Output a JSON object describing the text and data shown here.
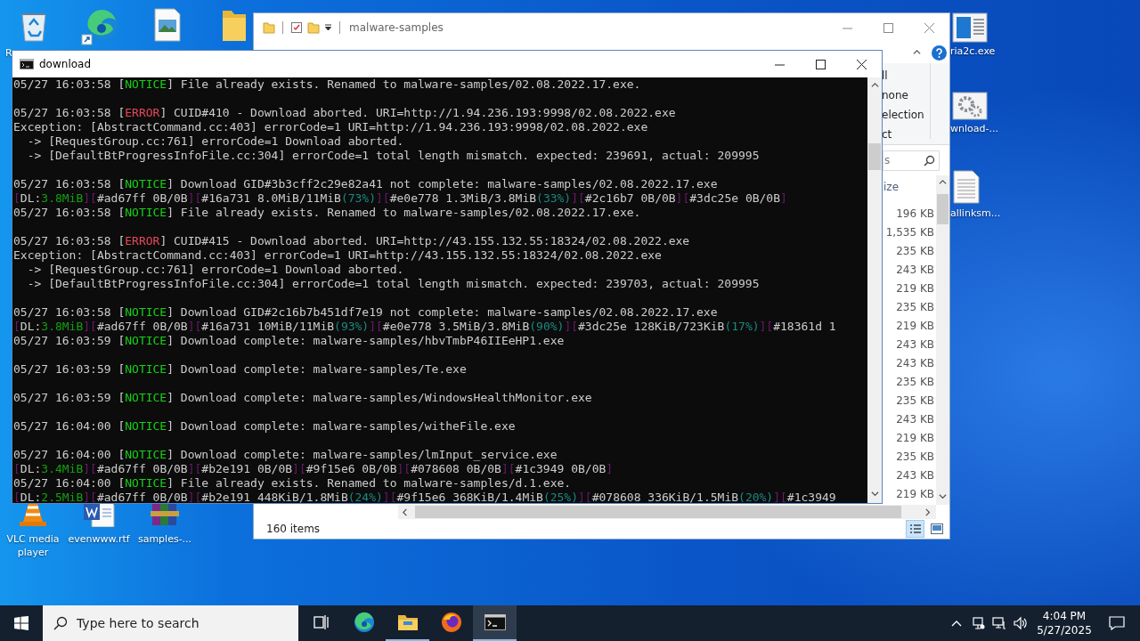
{
  "desktop_icons_top": [
    {
      "kind": "recycle",
      "label": "R"
    },
    {
      "kind": "edge"
    },
    {
      "kind": "image"
    },
    {
      "kind": "folder"
    }
  ],
  "desktop_icons_right": [
    {
      "kind": "app",
      "label": "ria2c.exe"
    },
    {
      "kind": "gear",
      "label": "wnload-..."
    },
    {
      "kind": "text",
      "label": "allinksm..."
    }
  ],
  "desktop_icons_bottom": [
    {
      "kind": "vlc",
      "label": "VLC media player"
    },
    {
      "kind": "word",
      "label": "evenwww.rtf"
    },
    {
      "kind": "archive",
      "label": "samples-..."
    }
  ],
  "explorer": {
    "title": "malware-samples",
    "ribbon_items": [
      "ll",
      "none",
      "election",
      "ct"
    ],
    "search": {
      "placeholder": "s"
    },
    "column": "ize",
    "sizes": [
      "196 KB",
      "1,535 KB",
      "235 KB",
      "243 KB",
      "219 KB",
      "235 KB",
      "219 KB",
      "243 KB",
      "243 KB",
      "235 KB",
      "235 KB",
      "243 KB",
      "219 KB",
      "235 KB",
      "243 KB",
      "219 KB"
    ],
    "status": "160 items",
    "views": [
      {
        "kind": "details",
        "selected": true
      },
      {
        "kind": "thumbnails",
        "selected": false
      }
    ]
  },
  "console": {
    "title": "download",
    "blocks": [
      {
        "lines": [
          {
            "segments": [
              {
                "kind": "text",
                "text": "05/27 16:03:58 ["
              },
              {
                "kind": "notice",
                "text": "NOTICE"
              },
              {
                "kind": "text",
                "text": "] File already exists. Renamed to malware-samples/02.08.2022.17.exe."
              }
            ]
          }
        ]
      },
      {
        "lines": [
          {
            "segments": [
              {
                "kind": "text",
                "text": "05/27 16:03:58 ["
              },
              {
                "kind": "error",
                "text": "ERROR"
              },
              {
                "kind": "text",
                "text": "] CUID#410 - Download aborted. URI=http://1.94.236.193:9998/02.08.2022.exe"
              }
            ]
          },
          {
            "segments": [
              {
                "kind": "text",
                "text": "Exception: [AbstractCommand.cc:403] errorCode=1 URI=http://1.94.236.193:9998/02.08.2022.exe"
              }
            ]
          },
          {
            "segments": [
              {
                "kind": "text",
                "text": "  -> [RequestGroup.cc:761] errorCode=1 Download aborted."
              }
            ]
          },
          {
            "segments": [
              {
                "kind": "text",
                "text": "  -> [DefaultBtProgressInfoFile.cc:304] errorCode=1 total length mismatch. expected: 239691, actual: 209995"
              }
            ]
          }
        ]
      },
      {
        "lines": [
          {
            "segments": [
              {
                "kind": "text",
                "text": "05/27 16:03:58 ["
              },
              {
                "kind": "notice",
                "text": "NOTICE"
              },
              {
                "kind": "text",
                "text": "] Download GID#3b3cff2c29e82a41 not complete: malware-samples/02.08.2022.17.exe"
              }
            ]
          },
          {
            "segments": [
              {
                "kind": "bracket",
                "text": "["
              },
              {
                "kind": "text",
                "text": "DL:"
              },
              {
                "kind": "speed",
                "text": "3.8MiB"
              },
              {
                "kind": "bracket",
                "text": "]["
              },
              {
                "kind": "text",
                "text": "#ad67ff 0B/0B"
              },
              {
                "kind": "bracket",
                "text": "]["
              },
              {
                "kind": "text",
                "text": "#16a731 8.0MiB/11MiB"
              },
              {
                "kind": "percent",
                "text": "(73%)"
              },
              {
                "kind": "bracket",
                "text": "]["
              },
              {
                "kind": "text",
                "text": "#e0e778 1.3MiB/3.8MiB"
              },
              {
                "kind": "percent",
                "text": "(33%)"
              },
              {
                "kind": "bracket",
                "text": "]["
              },
              {
                "kind": "text",
                "text": "#2c16b7 0B/0B"
              },
              {
                "kind": "bracket",
                "text": "]["
              },
              {
                "kind": "text",
                "text": "#3dc25e 0B/0B"
              },
              {
                "kind": "bracket",
                "text": "]"
              }
            ]
          },
          {
            "segments": [
              {
                "kind": "text",
                "text": "05/27 16:03:58 ["
              },
              {
                "kind": "notice",
                "text": "NOTICE"
              },
              {
                "kind": "text",
                "text": "] File already exists. Renamed to malware-samples/02.08.2022.17.exe."
              }
            ]
          }
        ]
      },
      {
        "lines": [
          {
            "segments": [
              {
                "kind": "text",
                "text": "05/27 16:03:58 ["
              },
              {
                "kind": "error",
                "text": "ERROR"
              },
              {
                "kind": "text",
                "text": "] CUID#415 - Download aborted. URI=http://43.155.132.55:18324/02.08.2022.exe"
              }
            ]
          },
          {
            "segments": [
              {
                "kind": "text",
                "text": "Exception: [AbstractCommand.cc:403] errorCode=1 URI=http://43.155.132.55:18324/02.08.2022.exe"
              }
            ]
          },
          {
            "segments": [
              {
                "kind": "text",
                "text": "  -> [RequestGroup.cc:761] errorCode=1 Download aborted."
              }
            ]
          },
          {
            "segments": [
              {
                "kind": "text",
                "text": "  -> [DefaultBtProgressInfoFile.cc:304] errorCode=1 total length mismatch. expected: 239703, actual: 209995"
              }
            ]
          }
        ]
      },
      {
        "lines": [
          {
            "segments": [
              {
                "kind": "text",
                "text": "05/27 16:03:58 ["
              },
              {
                "kind": "notice",
                "text": "NOTICE"
              },
              {
                "kind": "text",
                "text": "] Download GID#2c16b7b451df7e19 not complete: malware-samples/02.08.2022.17.exe"
              }
            ]
          },
          {
            "segments": [
              {
                "kind": "bracket",
                "text": "["
              },
              {
                "kind": "text",
                "text": "DL:"
              },
              {
                "kind": "speed",
                "text": "3.8MiB"
              },
              {
                "kind": "bracket",
                "text": "]["
              },
              {
                "kind": "text",
                "text": "#ad67ff 0B/0B"
              },
              {
                "kind": "bracket",
                "text": "]["
              },
              {
                "kind": "text",
                "text": "#16a731 10MiB/11MiB"
              },
              {
                "kind": "percent",
                "text": "(93%)"
              },
              {
                "kind": "bracket",
                "text": "]["
              },
              {
                "kind": "text",
                "text": "#e0e778 3.5MiB/3.8MiB"
              },
              {
                "kind": "percent",
                "text": "(90%)"
              },
              {
                "kind": "bracket",
                "text": "]["
              },
              {
                "kind": "text",
                "text": "#3dc25e 128KiB/723KiB"
              },
              {
                "kind": "percent",
                "text": "(17%)"
              },
              {
                "kind": "bracket",
                "text": "]["
              },
              {
                "kind": "text",
                "text": "#18361d 1"
              }
            ]
          },
          {
            "segments": [
              {
                "kind": "text",
                "text": "05/27 16:03:59 ["
              },
              {
                "kind": "notice",
                "text": "NOTICE"
              },
              {
                "kind": "text",
                "text": "] Download complete: malware-samples/hbvTmbP46IIEeHP1.exe"
              }
            ]
          }
        ]
      },
      {
        "lines": [
          {
            "segments": [
              {
                "kind": "text",
                "text": "05/27 16:03:59 ["
              },
              {
                "kind": "notice",
                "text": "NOTICE"
              },
              {
                "kind": "text",
                "text": "] Download complete: malware-samples/Te.exe"
              }
            ]
          }
        ]
      },
      {
        "lines": [
          {
            "segments": [
              {
                "kind": "text",
                "text": "05/27 16:03:59 ["
              },
              {
                "kind": "notice",
                "text": "NOTICE"
              },
              {
                "kind": "text",
                "text": "] Download complete: malware-samples/WindowsHealthMonitor.exe"
              }
            ]
          }
        ]
      },
      {
        "lines": [
          {
            "segments": [
              {
                "kind": "text",
                "text": "05/27 16:04:00 ["
              },
              {
                "kind": "notice",
                "text": "NOTICE"
              },
              {
                "kind": "text",
                "text": "] Download complete: malware-samples/witheFile.exe"
              }
            ]
          }
        ]
      },
      {
        "lines": [
          {
            "segments": [
              {
                "kind": "text",
                "text": "05/27 16:04:00 ["
              },
              {
                "kind": "notice",
                "text": "NOTICE"
              },
              {
                "kind": "text",
                "text": "] Download complete: malware-samples/lmInput_service.exe"
              }
            ]
          },
          {
            "segments": [
              {
                "kind": "bracket",
                "text": "["
              },
              {
                "kind": "text",
                "text": "DL:"
              },
              {
                "kind": "speed",
                "text": "3.4MiB"
              },
              {
                "kind": "bracket",
                "text": "]["
              },
              {
                "kind": "text",
                "text": "#ad67ff 0B/0B"
              },
              {
                "kind": "bracket",
                "text": "]["
              },
              {
                "kind": "text",
                "text": "#b2e191 0B/0B"
              },
              {
                "kind": "bracket",
                "text": "]["
              },
              {
                "kind": "text",
                "text": "#9f15e6 0B/0B"
              },
              {
                "kind": "bracket",
                "text": "]["
              },
              {
                "kind": "text",
                "text": "#078608 0B/0B"
              },
              {
                "kind": "bracket",
                "text": "]["
              },
              {
                "kind": "text",
                "text": "#1c3949 0B/0B"
              },
              {
                "kind": "bracket",
                "text": "]"
              }
            ]
          },
          {
            "segments": [
              {
                "kind": "text",
                "text": "05/27 16:04:00 ["
              },
              {
                "kind": "notice",
                "text": "NOTICE"
              },
              {
                "kind": "text",
                "text": "] File already exists. Renamed to malware-samples/d.1.exe."
              }
            ]
          },
          {
            "segments": [
              {
                "kind": "bracket",
                "text": "["
              },
              {
                "kind": "text",
                "text": "DL:"
              },
              {
                "kind": "speed",
                "text": "2.5MiB"
              },
              {
                "kind": "bracket",
                "text": "]["
              },
              {
                "kind": "text",
                "text": "#ad67ff 0B/0B"
              },
              {
                "kind": "bracket",
                "text": "]["
              },
              {
                "kind": "text",
                "text": "#b2e191 448KiB/1.8MiB"
              },
              {
                "kind": "percent",
                "text": "(24%)"
              },
              {
                "kind": "bracket",
                "text": "]["
              },
              {
                "kind": "text",
                "text": "#9f15e6 368KiB/1.4MiB"
              },
              {
                "kind": "percent",
                "text": "(25%)"
              },
              {
                "kind": "bracket",
                "text": "]["
              },
              {
                "kind": "text",
                "text": "#078608 336KiB/1.5MiB"
              },
              {
                "kind": "percent",
                "text": "(20%)"
              },
              {
                "kind": "bracket",
                "text": "]["
              },
              {
                "kind": "text",
                "text": "#1c3949"
              }
            ]
          }
        ]
      }
    ]
  },
  "taskbar": {
    "search": {
      "placeholder": "Type here to search"
    },
    "apps": [
      {
        "kind": "taskview",
        "active": false,
        "selected": false
      },
      {
        "kind": "edge",
        "active": false,
        "selected": false
      },
      {
        "kind": "explorer",
        "active": true,
        "selected": false
      },
      {
        "kind": "firefox",
        "active": false,
        "selected": false
      },
      {
        "kind": "cmd",
        "active": true,
        "selected": true
      }
    ],
    "time": "4:04 PM",
    "date": "5/27/2025"
  }
}
